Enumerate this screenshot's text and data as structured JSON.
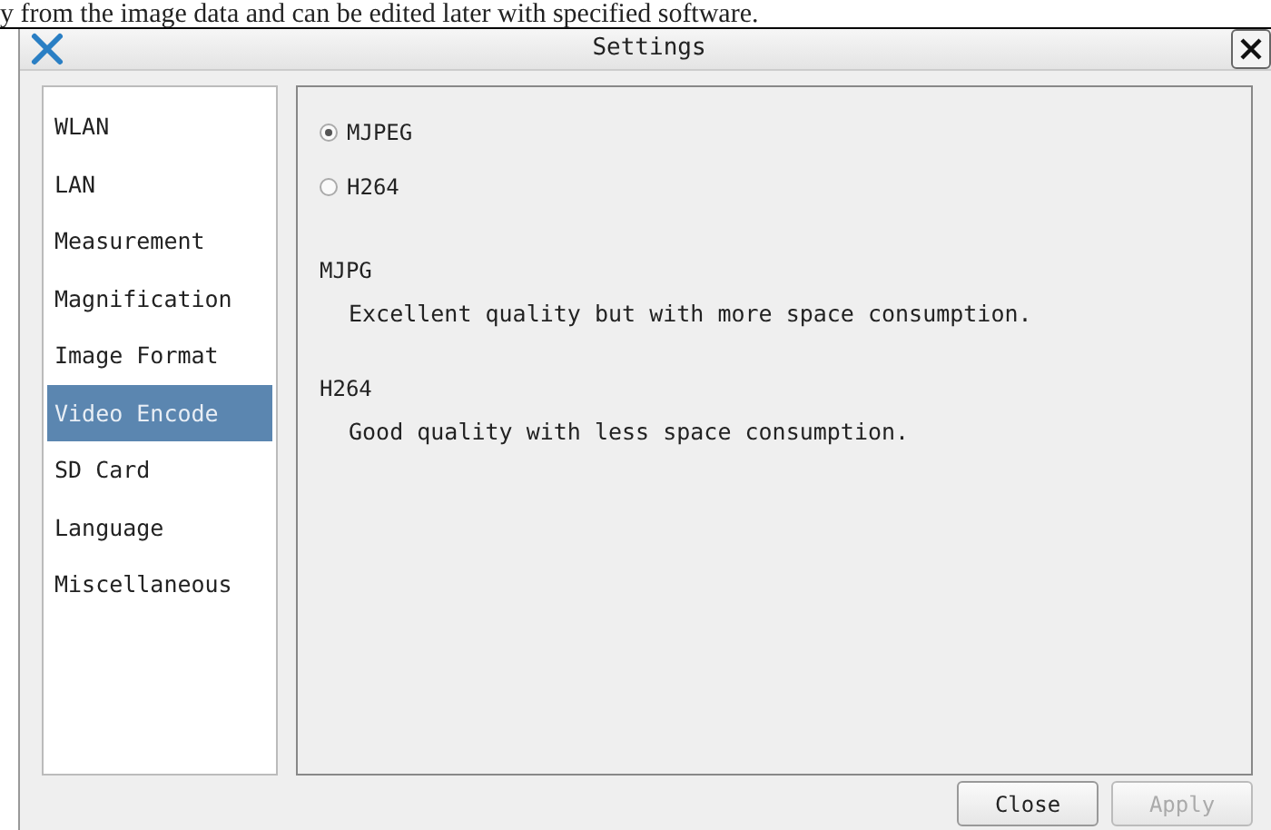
{
  "page_text": "y from the image data and can be edited later with specified software.",
  "window": {
    "title": "Settings"
  },
  "sidebar": {
    "items": [
      {
        "label": "WLAN",
        "selected": false
      },
      {
        "label": "LAN",
        "selected": false
      },
      {
        "label": "Measurement",
        "selected": false
      },
      {
        "label": "Magnification",
        "selected": false
      },
      {
        "label": "Image Format",
        "selected": false
      },
      {
        "label": "Video Encode",
        "selected": true
      },
      {
        "label": "SD Card",
        "selected": false
      },
      {
        "label": "Language",
        "selected": false
      },
      {
        "label": "Miscellaneous",
        "selected": false
      }
    ]
  },
  "options": [
    {
      "label": "MJPEG",
      "selected": true
    },
    {
      "label": "H264",
      "selected": false
    }
  ],
  "descriptions": [
    {
      "heading": "MJPG",
      "text": "Excellent quality but with more space consumption."
    },
    {
      "heading": "H264",
      "text": "Good quality with less space consumption."
    }
  ],
  "buttons": [
    {
      "label": "Close",
      "disabled": false
    },
    {
      "label": "Apply",
      "disabled": true
    }
  ]
}
